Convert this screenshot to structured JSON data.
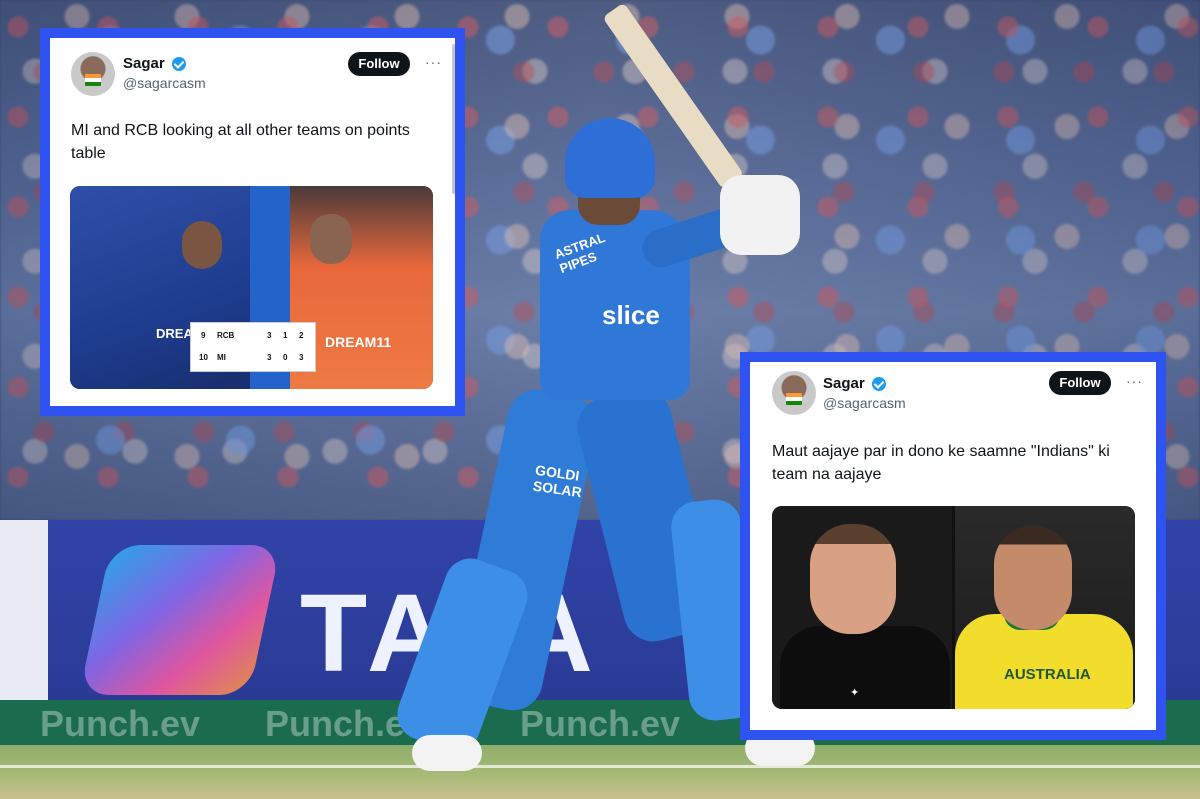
{
  "background": {
    "board_text": "TATA",
    "strip_text": [
      "Punch.ev",
      "Punch.ev",
      "Punch.ev"
    ],
    "jersey": {
      "sponsor1": "ASTRAL PIPES",
      "sponsor2": "slice",
      "sponsor3": "GOLDI SOLAR"
    }
  },
  "tweet1": {
    "name": "Sagar",
    "handle": "@sagarcasm",
    "follow_label": "Follow",
    "more": "···",
    "text": "MI and RCB looking at all other teams on points table",
    "media": {
      "shirt_text_right": "DREAM11",
      "shirt_text_left": "DREAM",
      "table_rows": [
        {
          "pos": "9",
          "team": "RCB",
          "p": "3",
          "w": "1",
          "l": "2"
        },
        {
          "pos": "10",
          "team": "MI",
          "p": "3",
          "w": "0",
          "l": "3"
        }
      ]
    }
  },
  "tweet2": {
    "name": "Sagar",
    "handle": "@sagarcasm",
    "follow_label": "Follow",
    "more": "···",
    "text": "Maut aajaye par in dono ke saamne \"Indians\" ki team na aajaye",
    "media": {
      "right_jersey_text": "AUSTRALIA"
    }
  },
  "colors": {
    "card_border": "#2f53f0",
    "verified": "#1d9bf0",
    "follow_bg": "#0f1419"
  }
}
